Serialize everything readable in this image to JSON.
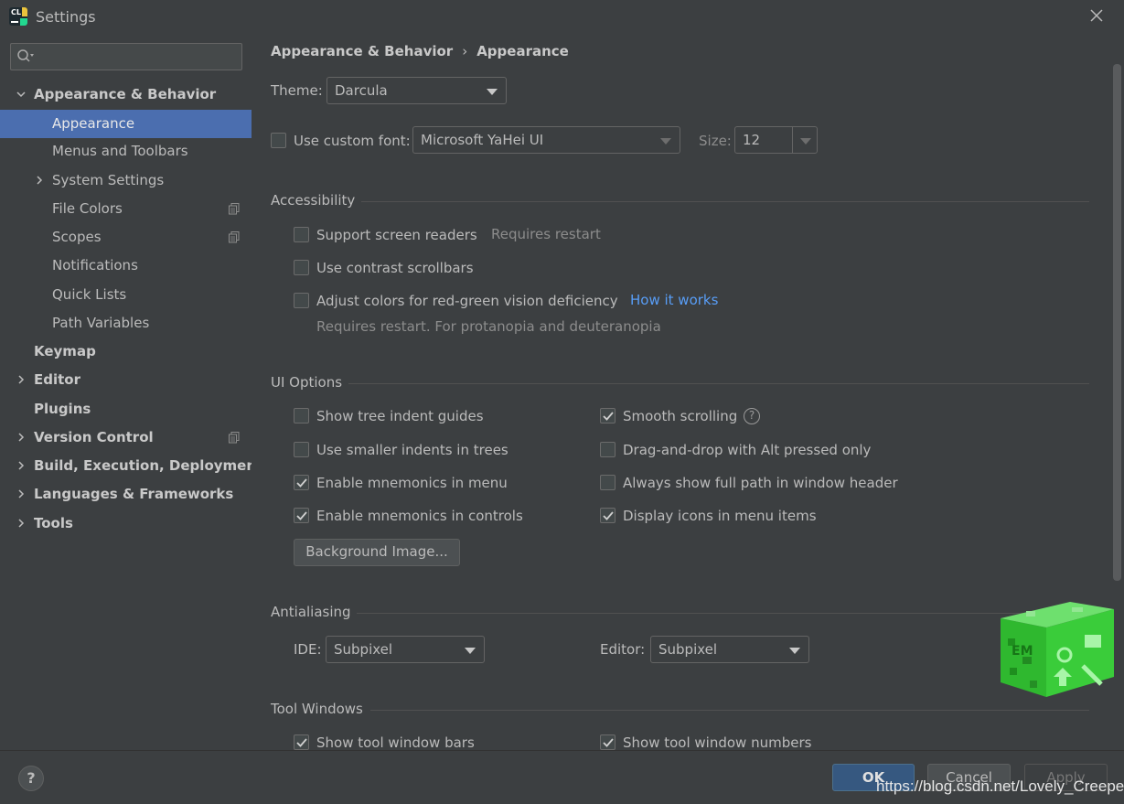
{
  "window": {
    "title": "Settings"
  },
  "sidebar": {
    "search": {
      "placeholder": ""
    },
    "items": [
      {
        "label": "Appearance & Behavior"
      },
      {
        "label": "Appearance"
      },
      {
        "label": "Menus and Toolbars"
      },
      {
        "label": "System Settings"
      },
      {
        "label": "File Colors"
      },
      {
        "label": "Scopes"
      },
      {
        "label": "Notifications"
      },
      {
        "label": "Quick Lists"
      },
      {
        "label": "Path Variables"
      },
      {
        "label": "Keymap"
      },
      {
        "label": "Editor"
      },
      {
        "label": "Plugins"
      },
      {
        "label": "Version Control"
      },
      {
        "label": "Build, Execution, Deployment"
      },
      {
        "label": "Languages & Frameworks"
      },
      {
        "label": "Tools"
      }
    ]
  },
  "breadcrumb": {
    "parent": "Appearance & Behavior",
    "separator": "›",
    "current": "Appearance"
  },
  "theme": {
    "label": "Theme:",
    "value": "Darcula"
  },
  "custom_font": {
    "label": "Use custom font:",
    "checked": false,
    "font": "Microsoft YaHei UI",
    "size_label": "Size:",
    "size": "12"
  },
  "accessibility": {
    "title": "Accessibility",
    "screen_readers": {
      "label": "Support screen readers",
      "checked": false,
      "hint": "Requires restart"
    },
    "contrast_scrollbars": {
      "label": "Use contrast scrollbars",
      "checked": false
    },
    "color_deficiency": {
      "label": "Adjust colors for red-green vision deficiency",
      "checked": false,
      "link": "How it works",
      "hint": "Requires restart. For protanopia and deuteranopia"
    }
  },
  "ui_options": {
    "title": "UI Options",
    "left": [
      {
        "label": "Show tree indent guides",
        "checked": false
      },
      {
        "label": "Use smaller indents in trees",
        "checked": false
      },
      {
        "label": "Enable mnemonics in menu",
        "checked": true
      },
      {
        "label": "Enable mnemonics in controls",
        "checked": true
      }
    ],
    "right": [
      {
        "label": "Smooth scrolling",
        "checked": true
      },
      {
        "label": "Drag-and-drop with Alt pressed only",
        "checked": false
      },
      {
        "label": "Always show full path in window header",
        "checked": false
      },
      {
        "label": "Display icons in menu items",
        "checked": true
      }
    ],
    "background_button": "Background Image..."
  },
  "antialiasing": {
    "title": "Antialiasing",
    "ide_label": "IDE:",
    "ide_value": "Subpixel",
    "editor_label": "Editor:",
    "editor_value": "Subpixel"
  },
  "tool_windows": {
    "title": "Tool Windows",
    "bars": {
      "label": "Show tool window bars",
      "checked": true
    },
    "numbers": {
      "label": "Show tool window numbers",
      "checked": true
    }
  },
  "footer": {
    "help": "?",
    "ok": "OK",
    "cancel": "Cancel",
    "apply": "Apply",
    "watermark": "https://blog.csdn.net/Lovely_Creeper"
  },
  "colors": {
    "background": "#3c3f41",
    "selection": "#4b6eaf",
    "link": "#589df6",
    "ok_button": "#365880"
  }
}
